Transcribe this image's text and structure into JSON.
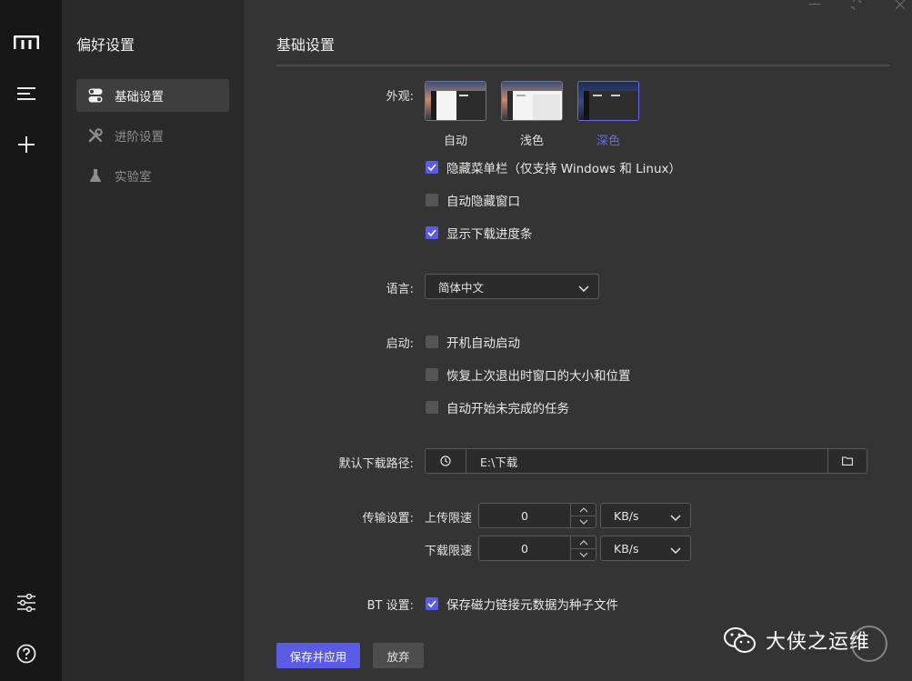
{
  "sidebar": {
    "title": "偏好设置",
    "items": [
      {
        "label": "基础设置",
        "icon": "toggle-icon",
        "active": true
      },
      {
        "label": "进阶设置",
        "icon": "tools-icon",
        "active": false
      },
      {
        "label": "实验室",
        "icon": "flask-icon",
        "active": false
      }
    ]
  },
  "rail": {
    "icons": [
      "logo-icon",
      "menu-icon",
      "plus-icon",
      "sliders-icon",
      "help-icon"
    ]
  },
  "page": {
    "title": "基础设置"
  },
  "appearance": {
    "label": "外观:",
    "themes": [
      {
        "label": "自动",
        "selected": false
      },
      {
        "label": "浅色",
        "selected": false
      },
      {
        "label": "深色",
        "selected": true
      }
    ],
    "options": [
      {
        "label": "隐藏菜单栏（仅支持 Windows 和 Linux）",
        "checked": true
      },
      {
        "label": "自动隐藏窗口",
        "checked": false
      },
      {
        "label": "显示下载进度条",
        "checked": true
      }
    ]
  },
  "language": {
    "label": "语言:",
    "value": "简体中文"
  },
  "startup": {
    "label": "启动:",
    "options": [
      {
        "label": "开机自动启动",
        "checked": false
      },
      {
        "label": "恢复上次退出时窗口的大小和位置",
        "checked": false
      },
      {
        "label": "自动开始未完成的任务",
        "checked": false
      }
    ]
  },
  "download_path": {
    "label": "默认下载路径:",
    "value": "E:\\下载"
  },
  "transfer": {
    "label": "传输设置:",
    "upload_label": "上传限速",
    "upload_value": "0",
    "upload_unit": "KB/s",
    "download_label": "下载限速",
    "download_value": "0",
    "download_unit": "KB/s"
  },
  "bt": {
    "label": "BT 设置:",
    "option": {
      "label": "保存磁力链接元数据为种子文件",
      "checked": true
    }
  },
  "actions": {
    "save_label": "保存并应用",
    "discard_label": "放弃"
  },
  "watermark": {
    "text": "大侠之运维"
  },
  "colors": {
    "accent": "#5b5be6",
    "rail_bg": "#171717",
    "sidebar_bg": "#2a2a2a",
    "main_bg": "#343434"
  }
}
